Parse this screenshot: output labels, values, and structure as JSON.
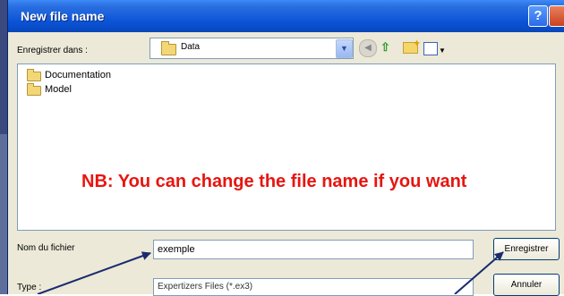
{
  "dialog": {
    "title": "New file name",
    "save_in_label": "Enregistrer dans :",
    "save_in_value": "Data",
    "files": [
      {
        "name": "Documentation"
      },
      {
        "name": "Model"
      }
    ],
    "filename_label": "Nom du fichier",
    "filename_value": "exemple",
    "type_label": "Type :",
    "type_value": "Expertizers Files (*.ex3)",
    "save_button": "Enregistrer",
    "cancel_button": "Annuler",
    "help_button": "?"
  },
  "annotation": {
    "note": "NB: You can change the file name if you want"
  },
  "icons": {
    "folder": "folder-icon",
    "back": "back-icon",
    "up": "up-folder-icon",
    "new_folder": "new-folder-icon",
    "view_menu": "view-menu-icon"
  },
  "colors": {
    "title_bar": "#0a52d6",
    "note_text": "#e8150f",
    "dialog_bg": "#ece9d8"
  }
}
